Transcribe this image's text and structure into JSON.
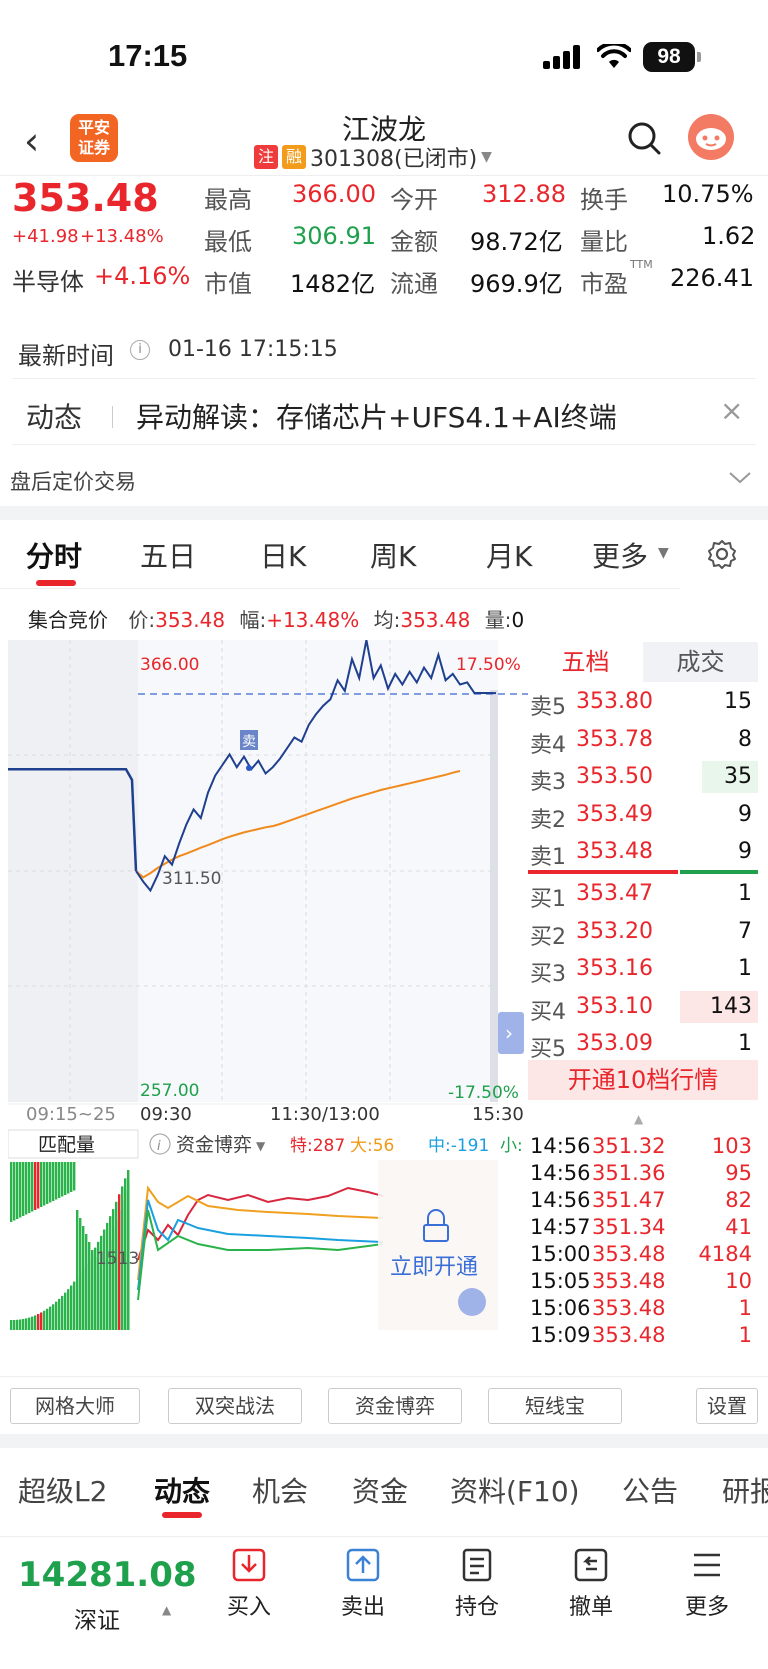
{
  "status_bar": {
    "time": "17:15",
    "battery": "98"
  },
  "header": {
    "title": "江波龙",
    "tag_margin": "注",
    "tag_financing": "融",
    "code_status": "301308(已闭市)",
    "logo_text_1": "平安",
    "logo_text_2": "证券"
  },
  "quote": {
    "price": "353.48",
    "change": "+41.98",
    "change_pct": "+13.48%",
    "sector_name": "半导体",
    "sector_pct": "+4.16%",
    "high_label": "最高",
    "high": "366.00",
    "low_label": "最低",
    "low": "306.91",
    "mktcap_label": "市值",
    "mktcap": "1482亿",
    "open_label": "今开",
    "open": "312.88",
    "amount_label": "金额",
    "amount": "98.72亿",
    "float_label": "流通",
    "float": "969.9亿",
    "turnover_label": "换手",
    "turnover": "10.75%",
    "volratio_label": "量比",
    "volratio": "1.62",
    "pe_label": "市盈",
    "pe_sup": "TTM",
    "pe": "226.41"
  },
  "update": {
    "label": "最新时间",
    "value": "01-16 17:15:15"
  },
  "news": {
    "tag": "动态",
    "text": "异动解读：存储芯片+UFS4.1+AI终端"
  },
  "after_hours": {
    "label": "盘后定价交易"
  },
  "chart_tabs": [
    "分时",
    "五日",
    "日K",
    "周K",
    "月K",
    "更多"
  ],
  "auction_bar": {
    "label": "集合竞价",
    "price_label": "价:",
    "price": "353.48",
    "pct_label": "幅:",
    "pct": "+13.48%",
    "avg_label": "均:",
    "avg": "353.48",
    "vol_label": "量:",
    "vol": "0"
  },
  "chart_data": {
    "type": "line",
    "y_high": "366.00",
    "y_mid": "311.50",
    "y_low": "257.00",
    "pct_high": "17.50%",
    "pct_low": "-17.50%",
    "sell_marker": "卖",
    "time_labels": [
      "09:15~25",
      "09:30",
      "11:30/13:00",
      "15:30"
    ],
    "ylim": [
      257.0,
      366.0
    ],
    "series": [
      {
        "name": "价",
        "values": [
          311.5,
          309.0,
          306.9,
          310.5,
          315.0,
          313.0,
          318.0,
          322.5,
          326.0,
          324.0,
          330.0,
          334.0,
          336.5,
          339.0,
          336.0,
          338.5,
          335.5,
          337.5,
          334.5,
          336.0,
          338.0,
          340.5,
          343.0,
          342.0,
          346.0,
          348.5,
          350.5,
          352.0,
          356.5,
          354.0,
          361.5,
          357.0,
          366.0,
          357.0,
          360.0,
          354.5,
          358.0,
          355.5,
          358.5,
          356.0,
          359.5,
          357.0,
          362.5,
          356.5,
          358.0,
          355.5,
          356.0,
          353.5,
          353.5,
          353.5,
          353.48
        ]
      },
      {
        "name": "均",
        "values": [
          311.5,
          310.0,
          311.0,
          312.2,
          313.2,
          314.2,
          315.0,
          315.6,
          316.3,
          317.0,
          317.6,
          318.3,
          319.0,
          319.6,
          320.1,
          320.6,
          321.0,
          321.4,
          321.8,
          322.1,
          322.6,
          323.2,
          323.8,
          324.4,
          325.0,
          325.6,
          326.2,
          326.8,
          327.4,
          328.0,
          328.6,
          329.1,
          329.6,
          330.1,
          330.6,
          331.0,
          331.4,
          331.8,
          332.2,
          332.6,
          333.0,
          333.4,
          333.8,
          334.2,
          334.7,
          335.1
        ]
      }
    ],
    "ref_price": 353.48
  },
  "sub_chart": {
    "label": "匹配量",
    "fund_label": "资金博弈",
    "te_label": "特:",
    "te": "287",
    "da_label": "大:",
    "da": "56",
    "zhong_label": "中:",
    "zhong": "-191",
    "xiao_label": "小:",
    "vol_mark": "1513",
    "unlock_text": "立即开通"
  },
  "orderbook": {
    "tab_active": "五档",
    "tab_other": "成交",
    "asks": [
      {
        "label": "卖5",
        "price": "353.80",
        "vol": "15"
      },
      {
        "label": "卖4",
        "price": "353.78",
        "vol": "8"
      },
      {
        "label": "卖3",
        "price": "353.50",
        "vol": "35"
      },
      {
        "label": "卖2",
        "price": "353.49",
        "vol": "9"
      },
      {
        "label": "卖1",
        "price": "353.48",
        "vol": "9"
      }
    ],
    "bids": [
      {
        "label": "买1",
        "price": "353.47",
        "vol": "1"
      },
      {
        "label": "买2",
        "price": "353.20",
        "vol": "7"
      },
      {
        "label": "买3",
        "price": "353.16",
        "vol": "1"
      },
      {
        "label": "买4",
        "price": "353.10",
        "vol": "143"
      },
      {
        "label": "买5",
        "price": "353.09",
        "vol": "1"
      }
    ],
    "upgrade": "开通10档行情",
    "trades": [
      {
        "time": "14:56",
        "price": "351.32",
        "vol": "103"
      },
      {
        "time": "14:56",
        "price": "351.36",
        "vol": "95"
      },
      {
        "time": "14:56",
        "price": "351.47",
        "vol": "82"
      },
      {
        "time": "14:57",
        "price": "351.34",
        "vol": "41"
      },
      {
        "time": "15:00",
        "price": "353.48",
        "vol": "4184"
      },
      {
        "time": "15:05",
        "price": "353.48",
        "vol": "10"
      },
      {
        "time": "15:06",
        "price": "353.48",
        "vol": "1"
      },
      {
        "time": "15:09",
        "price": "353.48",
        "vol": "1"
      }
    ]
  },
  "tool_buttons": [
    "网格大师",
    "双突战法",
    "资金博弈",
    "短线宝",
    "设置"
  ],
  "bottom_tabs": [
    "超级L2",
    "动态",
    "机会",
    "资金",
    "资料(F10)",
    "公告",
    "研报"
  ],
  "dock": {
    "index_value": "14281.08",
    "index_name": "深证",
    "buy": "买入",
    "sell": "卖出",
    "position": "持仓",
    "cancel": "撤单",
    "more": "更多"
  },
  "colors": {
    "up": "#e8262b",
    "down": "#1ea04c",
    "price_line": "#1f3f8f",
    "avg_line": "#f08a1c"
  }
}
